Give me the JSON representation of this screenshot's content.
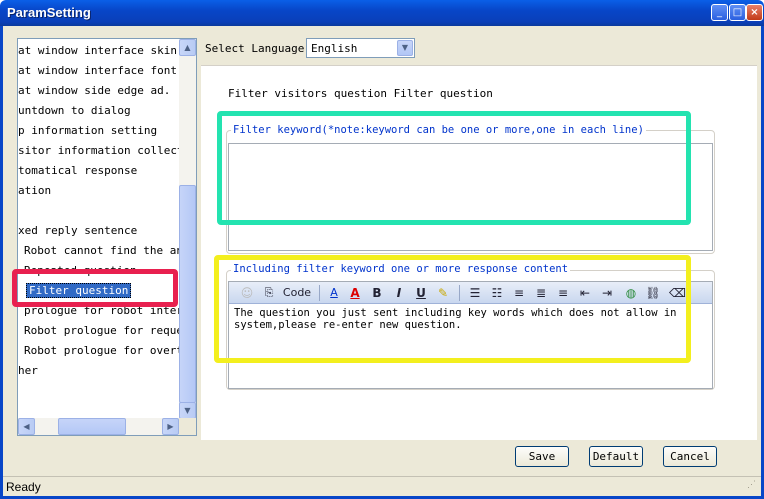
{
  "window": {
    "title": "ParamSetting"
  },
  "title_buttons": {
    "minimize": "_",
    "maximize": "□",
    "close": "×"
  },
  "tree": {
    "items": [
      "at window interface skin se",
      "at window interface font co",
      "at window side edge ad.",
      "untdown to dialog",
      "p information setting",
      "sitor information collect",
      "tomatical response",
      "ation",
      "",
      "xed reply sentence",
      "Robot cannot find the answ",
      "Repeated question",
      "Filter question",
      "prologue for robot interre",
      "Robot prologue for request",
      "Robot prologue for overtim",
      "her"
    ],
    "selected_index": 12
  },
  "language": {
    "label": "Select Language",
    "value": "English"
  },
  "filter": {
    "title": "Filter visitors question Filter question",
    "keyword_group_label": "Filter keyword(*note:keyword can be one or more,one in each line)",
    "keyword_value": "",
    "response_group_label": "Including filter keyword one or more response content",
    "response_text": "The question you just sent including key words which does not allow in system,please re-enter new question."
  },
  "toolbar": {
    "code_label": "Code",
    "bold": "B",
    "italic": "I",
    "underline": "U",
    "font_color": "A",
    "font_size": "A"
  },
  "buttons": {
    "save": "Save",
    "default": "Default",
    "cancel": "Cancel"
  },
  "status": {
    "text": "Ready"
  },
  "colors": {
    "titlebar": "#0846c8",
    "selection": "#316ac5",
    "annotation_red": "#e8204f",
    "annotation_green": "#23e3b0",
    "annotation_yellow": "#f3ef1e",
    "group_label": "#0033cc"
  }
}
